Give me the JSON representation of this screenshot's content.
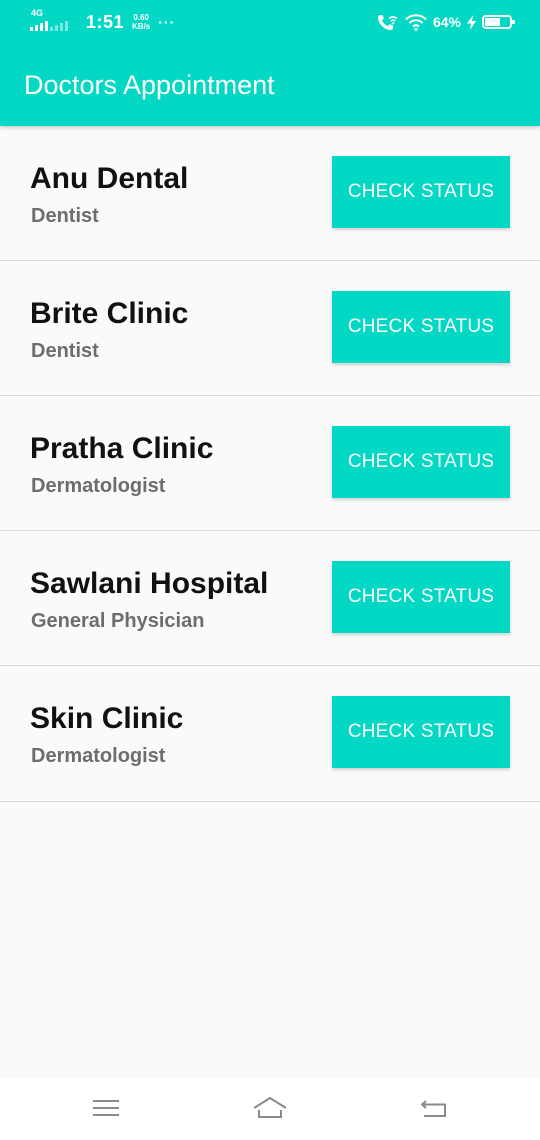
{
  "status_bar": {
    "network": "4G",
    "time": "1:51",
    "speed_value": "0.60",
    "speed_unit": "KB/s",
    "more": "···",
    "battery_percent": "64%",
    "battery_level": 0.64,
    "icons": [
      "signal-icon",
      "more-dots-icon",
      "wifi-calling-icon",
      "wifi-icon",
      "charging-bolt-icon",
      "battery-icon"
    ]
  },
  "app_bar": {
    "title": "Doctors Appointment"
  },
  "appointments": [
    {
      "name": "Anu Dental",
      "specialty": "Dentist",
      "button_label": "CHECK STATUS"
    },
    {
      "name": "Brite Clinic",
      "specialty": "Dentist",
      "button_label": "CHECK STATUS"
    },
    {
      "name": "Pratha Clinic",
      "specialty": "Dermatologist",
      "button_label": "CHECK STATUS"
    },
    {
      "name": "Sawlani Hospital",
      "specialty": "General Physician",
      "button_label": "CHECK STATUS"
    },
    {
      "name": "Skin Clinic",
      "specialty": "Dermatologist",
      "button_label": "CHECK STATUS"
    }
  ],
  "nav_bar": {
    "icons": [
      "menu-icon",
      "home-icon",
      "back-icon"
    ]
  },
  "colors": {
    "accent": "#03d8c5",
    "background": "#fafafa",
    "primary_text": "#111111",
    "secondary_text": "#6d6d6d",
    "divider": "#dadada"
  }
}
